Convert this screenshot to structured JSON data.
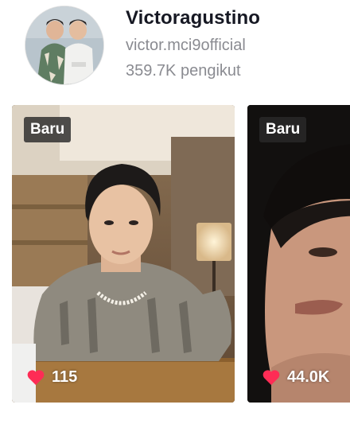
{
  "profile": {
    "display_name": "Victoragustino",
    "handle": "victor.mci9official",
    "followers": "359.7K pengikut",
    "avatar_icon": "profile-avatar-icon"
  },
  "videos": [
    {
      "badge": "Baru",
      "likes": "115",
      "heart_icon": "heart-icon"
    },
    {
      "badge": "Baru",
      "likes": "44.0K",
      "heart_icon": "heart-icon"
    }
  ],
  "colors": {
    "heart": "#fe2c55",
    "name": "#161823",
    "secondary_text": "#8a8b91",
    "badge_bg": "#2a2a2a"
  }
}
